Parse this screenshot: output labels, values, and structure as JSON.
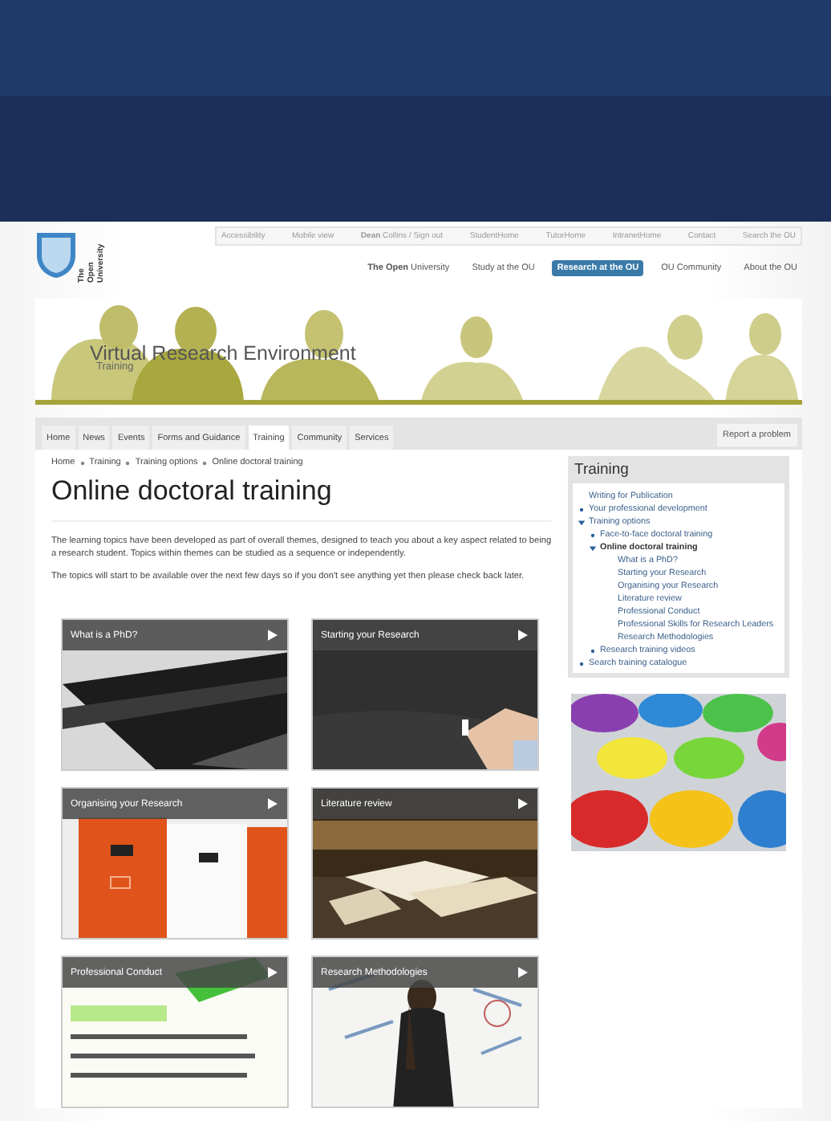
{
  "utility_links": [
    "Accessibility",
    "Mobile view",
    "**Dean** Collins / Sign out",
    "StudentHome",
    "TutorHome",
    "IntranetHome",
    "Contact",
    "Search the OU"
  ],
  "logo": {
    "text": "The Open University"
  },
  "main_nav": [
    {
      "label": "**The Open** University",
      "selected": false
    },
    {
      "label": "Study at the OU",
      "selected": false
    },
    {
      "label": "Research at the OU",
      "selected": true
    },
    {
      "label": "OU Community",
      "selected": false
    },
    {
      "label": "About the OU",
      "selected": false
    }
  ],
  "banner": {
    "title": "Virtual Research Environment",
    "subtitle": "Training"
  },
  "tabs": [
    {
      "label": "Home",
      "selected": false
    },
    {
      "label": "News",
      "selected": false
    },
    {
      "label": "Events",
      "selected": false
    },
    {
      "label": "Forms and Guidance",
      "selected": false
    },
    {
      "label": "Training",
      "selected": true
    },
    {
      "label": "Community",
      "selected": false
    },
    {
      "label": "Services",
      "selected": false
    }
  ],
  "report_link": "Report a problem",
  "breadcrumb": [
    "Home",
    "Training",
    "Training options",
    "Online doctoral training"
  ],
  "title": "Online doctoral training",
  "paragraphs": [
    "The learning topics have been developed as part of overall themes, designed to teach you about a key aspect related to being a research student. Topics within themes can be studied as a sequence or independently.",
    "The topics will start to be available over the next few days so if you don't see anything yet then please check back later."
  ],
  "tiles": [
    {
      "title": "What is a PhD?",
      "kind": "picture"
    },
    {
      "title": "Starting your Research",
      "kind": "picture"
    },
    {
      "title": "Organising your Research",
      "kind": "picture"
    },
    {
      "title": "Literature review",
      "kind": "picture"
    },
    {
      "title": "Professional Conduct",
      "kind": "picture"
    },
    {
      "title": "Research Methodologies",
      "kind": "picture"
    }
  ],
  "sidebar": {
    "title": "Training",
    "items": [
      {
        "label": "Writing for Publication",
        "kind": "page"
      },
      {
        "label": "Your professional development",
        "kind": "section",
        "expanded": false
      },
      {
        "label": "Training options",
        "kind": "section",
        "expanded": true,
        "children": [
          {
            "label": "Face-to-face doctoral training",
            "kind": "section",
            "expanded": false
          },
          {
            "label": "Online doctoral training",
            "kind": "section",
            "expanded": true,
            "current": true,
            "children": [
              {
                "label": "What is a PhD?",
                "kind": "page"
              },
              {
                "label": "Starting your Research",
                "kind": "page"
              },
              {
                "label": "Organising your Research",
                "kind": "page"
              },
              {
                "label": "Literature review",
                "kind": "page"
              },
              {
                "label": "Professional Conduct",
                "kind": "page"
              },
              {
                "label": "Professional Skills for Research Leaders",
                "kind": "page"
              },
              {
                "label": "Research Methodologies",
                "kind": "page"
              }
            ]
          },
          {
            "label": "Research training videos",
            "kind": "section",
            "expanded": false
          }
        ]
      },
      {
        "label": "Search training catalogue",
        "kind": "section",
        "expanded": false
      }
    ]
  },
  "sidebar_picture": {
    "kind": "picture"
  }
}
